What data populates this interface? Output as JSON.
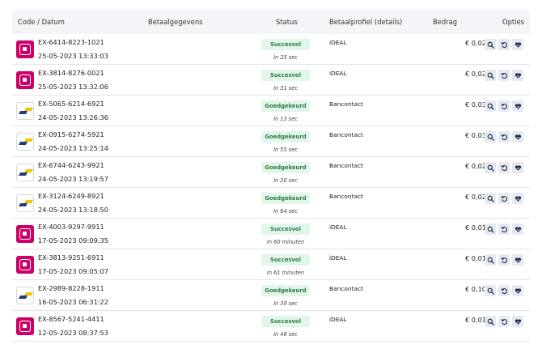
{
  "table": {
    "headers": {
      "code_datum": "Code / Datum",
      "betaalgegevens": "Betaalgegevens",
      "status": "Status",
      "betaalprofiel": "Betaalprofiel (details)",
      "bedrag": "Bedrag",
      "opties": "Opties"
    },
    "rows": [
      {
        "method": "ideal",
        "code": "EX-6414-8223-1021",
        "date": "25-05-2023 13:33:03",
        "status": "Succesvol",
        "since": "In 25 sec",
        "profile": "iDEAL",
        "amount": "€ 0,02"
      },
      {
        "method": "ideal",
        "code": "EX-3814-8276-0021",
        "date": "25-05-2023 13:32:06",
        "status": "Succesvol",
        "since": "In 31 sec",
        "profile": "iDEAL",
        "amount": "€ 0,02"
      },
      {
        "method": "bancontact",
        "code": "EX-5065-6214-6921",
        "date": "24-05-2023 13:26:36",
        "status": "Goedgekeurd",
        "since": "In 13 sec",
        "profile": "Bancontact",
        "amount": "€ 0,03"
      },
      {
        "method": "bancontact",
        "code": "EX-0915-6274-5921",
        "date": "24-05-2023 13:25:14",
        "status": "Goedgekeurd",
        "since": "In 55 sec",
        "profile": "Bancontact",
        "amount": "€ 0,03"
      },
      {
        "method": "bancontact",
        "code": "EX-6744-6243-9921",
        "date": "24-05-2023 13:19:57",
        "status": "Goedgekeurd",
        "since": "In 20 sec",
        "profile": "Bancontact",
        "amount": "€ 0,02"
      },
      {
        "method": "bancontact",
        "code": "EX-3124-6249-8921",
        "date": "24-05-2023 13:18:50",
        "status": "Goedgekeurd",
        "since": "In 64 sec",
        "profile": "Bancontact",
        "amount": "€ 0,02"
      },
      {
        "method": "ideal",
        "code": "EX-4003-9297-9911",
        "date": "17-05-2023 09:09:35",
        "status": "Succesvol",
        "since": "In 60 minuten",
        "profile": "iDEAL",
        "amount": "€ 0,01"
      },
      {
        "method": "ideal",
        "code": "EX-3813-9251-6911",
        "date": "17-05-2023 09:05:07",
        "status": "Succesvol",
        "since": "In 61 minuten",
        "profile": "iDEAL",
        "amount": "€ 0,01"
      },
      {
        "method": "bancontact",
        "code": "EX-2989-8228-1911",
        "date": "16-05-2023 06:31:22",
        "status": "Goedgekeurd",
        "since": "In 39 sec",
        "profile": "Bancontact",
        "amount": "€ 0,10"
      },
      {
        "method": "ideal",
        "code": "EX-8567-5241-4411",
        "date": "12-05-2023 08:37:53",
        "status": "Succesvol",
        "since": "In 46 sec",
        "profile": "iDEAL",
        "amount": "€ 0,01"
      }
    ]
  },
  "icons": {
    "action_1": "search-icon",
    "action_2": "refund-icon",
    "action_3": "heart-icon"
  },
  "colors": {
    "ideal_brand": "#cc0066",
    "status_text": "#2e7d4a",
    "status_bg": "#e3f6ea",
    "action_bg": "#e4e9f2",
    "header_bg": "#f3f5f8"
  }
}
